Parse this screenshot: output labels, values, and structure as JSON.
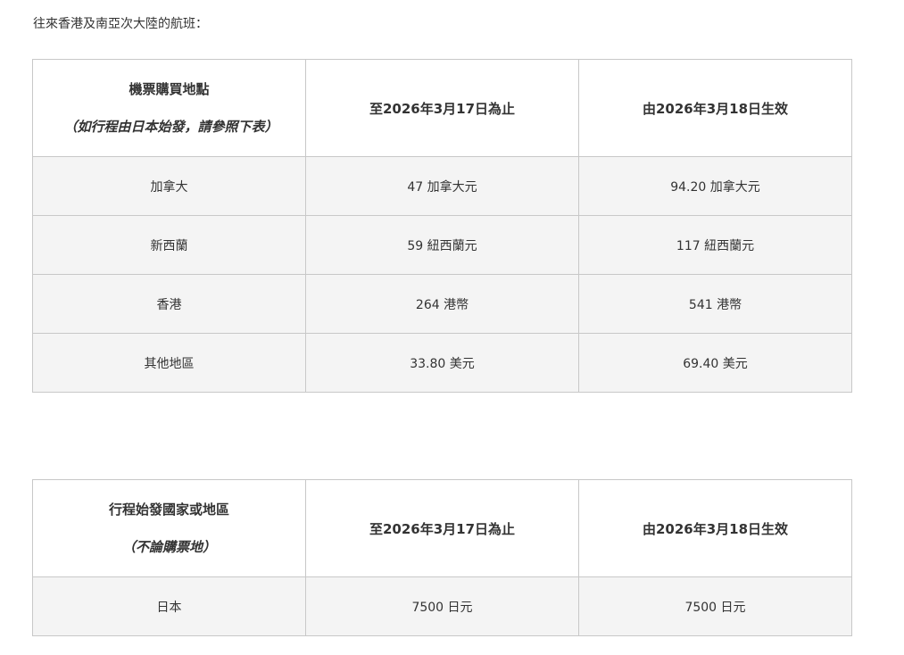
{
  "intro_text": "往來香港及南亞次大陸的航班：",
  "table1": {
    "header": {
      "col1_title": "機票購買地點",
      "col1_sub": "（如行程由日本始發，請參照下表）",
      "col2": "至2026年3月17日為止",
      "col3": "由2026年3月18日生效"
    },
    "rows": [
      {
        "place": "加拿大",
        "before": "47 加拿大元",
        "after": "94.20 加拿大元"
      },
      {
        "place": "新西蘭",
        "before": "59 紐西蘭元",
        "after": "117 紐西蘭元"
      },
      {
        "place": "香港",
        "before": "264 港幣",
        "after": "541 港幣"
      },
      {
        "place": "其他地區",
        "before": "33.80 美元",
        "after": "69.40 美元"
      }
    ]
  },
  "table2": {
    "header": {
      "col1_title": "行程始發國家或地區",
      "col1_sub": "（不論購票地）",
      "col2": "至2026年3月17日為止",
      "col3": "由2026年3月18日生效"
    },
    "rows": [
      {
        "place": "日本",
        "before": "7500 日元",
        "after": "7500 日元"
      }
    ]
  }
}
